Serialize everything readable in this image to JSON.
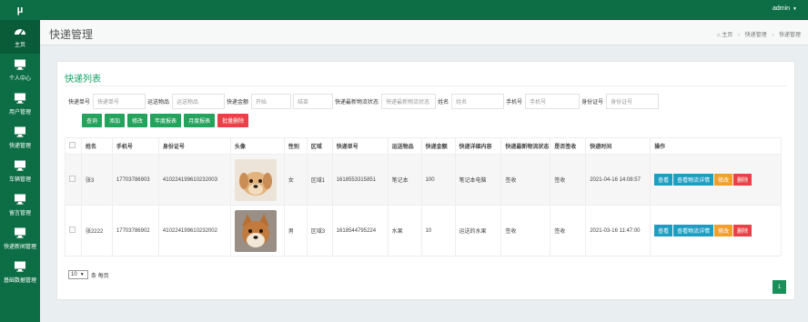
{
  "app": {
    "logo": "μ",
    "user": "admin"
  },
  "sidebar": {
    "items": [
      {
        "label": "主页",
        "icon": "dashboard-icon"
      },
      {
        "label": "个人中心",
        "icon": "monitor-icon"
      },
      {
        "label": "用户管理",
        "icon": "monitor-icon"
      },
      {
        "label": "快递管理",
        "icon": "monitor-icon"
      },
      {
        "label": "车辆管理",
        "icon": "monitor-icon"
      },
      {
        "label": "留言管理",
        "icon": "monitor-icon"
      },
      {
        "label": "快递新闻管理",
        "icon": "monitor-icon"
      },
      {
        "label": "基础数据管理",
        "icon": "monitor-icon"
      }
    ]
  },
  "header": {
    "title": "快递管理",
    "breadcrumb": [
      "主页",
      "快递管理",
      "快递管理"
    ]
  },
  "list": {
    "title": "快递列表"
  },
  "filters": {
    "tracking_label": "快递单号",
    "tracking_placeholder": "快递单号",
    "goods_label": "运送物品",
    "goods_placeholder": "运送物品",
    "amount_label": "快递金额",
    "amount_start_placeholder": "开始",
    "amount_end_placeholder": "结束",
    "status_label": "快递最新物流状态",
    "status_placeholder": "快递最新物流状态",
    "name_label": "姓名",
    "name_placeholder": "姓名",
    "phone_label": "手机号",
    "phone_placeholder": "手机号",
    "id_label": "身份证号",
    "id_placeholder": "身份证号"
  },
  "buttons": {
    "search": "查询",
    "add": "添加",
    "edit": "修改",
    "yearly": "年度报表",
    "monthly": "月度报表",
    "batch_delete": "批量删除"
  },
  "table": {
    "headers": [
      "姓名",
      "手机号",
      "身份证号",
      "头像",
      "性别",
      "区域",
      "快递单号",
      "运送物品",
      "快递金额",
      "快递详细内容",
      "快递最新物流状态",
      "是否签收",
      "快递时间",
      "操作"
    ],
    "rows": [
      {
        "name": "张3",
        "phone": "17703786903",
        "id": "410224199610232003",
        "avatar": "puppy-photo",
        "gender": "女",
        "area": "区域1",
        "tracking": "1618553315851",
        "goods": "笔记本",
        "amount": "100",
        "detail": "笔记本电脑",
        "status": "签收",
        "signed": "签收",
        "time": "2021-04-16 14:08:57"
      },
      {
        "name": "张2222",
        "phone": "17703786902",
        "id": "410224199610232002",
        "avatar": "shiba-photo",
        "gender": "男",
        "area": "区域3",
        "tracking": "1618544795224",
        "goods": "水果",
        "amount": "10",
        "detail": "运送的水果",
        "status": "签收",
        "signed": "签收",
        "time": "2021-03-16 11:47:00"
      }
    ],
    "actions": {
      "view": "查看",
      "view_logistics": "查看物流详情",
      "edit": "修改",
      "delete": "删除"
    }
  },
  "pagination": {
    "page_size": "10",
    "page_size_suffix": "条 每页",
    "current_page": "1"
  },
  "colors": {
    "brand": "#0d6e45",
    "accent": "#10a162",
    "button_green": "#23a35c",
    "button_red": "#e94147",
    "button_blue": "#1c9dc2",
    "button_orange": "#f0a12a"
  }
}
